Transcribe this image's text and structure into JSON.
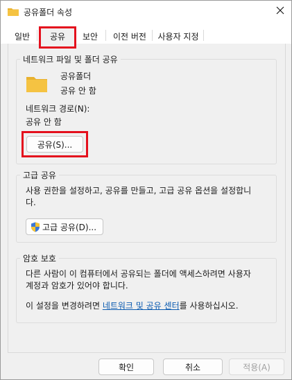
{
  "window": {
    "title": "공유폴더 속성",
    "close_label": "✕"
  },
  "tabs": [
    {
      "label": "일반"
    },
    {
      "label": "공유",
      "active": true
    },
    {
      "label": "보안"
    },
    {
      "label": "이전 버전"
    },
    {
      "label": "사용자 지정"
    }
  ],
  "network_sharing": {
    "group_title": "네트워크 파일 및 폴더 공유",
    "folder_name": "공유폴더",
    "folder_status": "공유 안 함",
    "path_label": "네트워크 경로(N):",
    "path_value": "공유 안 함",
    "share_button": "공유(S)..."
  },
  "advanced_sharing": {
    "group_title": "고급 공유",
    "description_line1": "사용 권한을 설정하고, 공유를 만들고, 고급 공유 옵션을 설정합니",
    "description_line2": "다.",
    "button": "고급 공유(D)..."
  },
  "password_protection": {
    "group_title": "암호 보호",
    "line1": "다른 사람이 이 컴퓨터에서 공유되는 폴더에 액세스하려면 사용자",
    "line2": "계정과 암호가 있어야 합니다.",
    "line3_prefix": "이 설정을 변경하려면 ",
    "line3_link": "네트워크 및 공유 센터",
    "line3_suffix": "를 사용하십시오."
  },
  "footer": {
    "ok": "확인",
    "cancel": "취소",
    "apply": "적용(A)"
  },
  "colors": {
    "highlight": "#e4101d",
    "link": "#0a5ab0",
    "folder": "#f5c342"
  },
  "icons": {
    "title": "folder-icon",
    "folder": "folder-icon",
    "shield": "uac-shield-icon",
    "close": "close-icon"
  }
}
